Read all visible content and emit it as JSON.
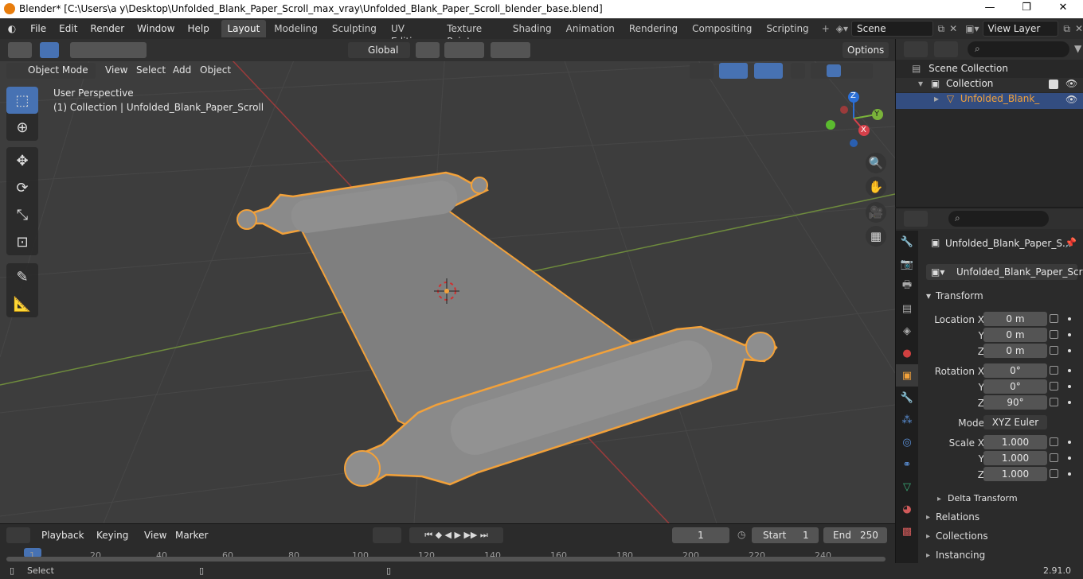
{
  "window": {
    "title": "Blender* [C:\\Users\\a y\\Desktop\\Unfolded_Blank_Paper_Scroll_max_vray\\Unfolded_Blank_Paper_Scroll_blender_base.blend]",
    "min": "—",
    "max": "❐",
    "close": "✕"
  },
  "menus": [
    "File",
    "Edit",
    "Render",
    "Window",
    "Help"
  ],
  "workspaces": [
    "Layout",
    "Modeling",
    "Sculpting",
    "UV Editing",
    "Texture Paint",
    "Shading",
    "Animation",
    "Rendering",
    "Compositing",
    "Scripting"
  ],
  "scene": {
    "name": "Scene"
  },
  "view_layer": {
    "name": "View Layer"
  },
  "viewport": {
    "mode": "Object Mode",
    "menus": [
      "View",
      "Select",
      "Add",
      "Object"
    ],
    "transform_orientation": "Global",
    "options_label": "Options",
    "perspective_label": "User Perspective",
    "collection_label": "(1) Collection | Unfolded_Blank_Paper_Scroll",
    "gizmo": {
      "z": "Z",
      "y": "Y",
      "x": "X"
    }
  },
  "outliner": {
    "items": [
      "Scene Collection",
      "Collection",
      "Unfolded_Blank_Paper_Scroll"
    ]
  },
  "properties": {
    "object_name_short": "Unfolded_Blank_Paper_S...",
    "object_name": "Unfolded_Blank_Paper_Scroll",
    "transform_header": "Transform",
    "location_label": "Location X",
    "y_label": "Y",
    "z_label": "Z",
    "location": [
      "0 m",
      "0 m",
      "0 m"
    ],
    "rotation_label": "Rotation X",
    "rotation": [
      "0°",
      "0°",
      "90°"
    ],
    "mode_label": "Mode",
    "mode_value": "XYZ Euler",
    "scale_label": "Scale X",
    "scale": [
      "1.000",
      "1.000",
      "1.000"
    ],
    "delta": "Delta Transform",
    "sections": [
      "Relations",
      "Collections",
      "Instancing"
    ]
  },
  "timeline": {
    "menus": [
      "Playback",
      "Keying",
      "View",
      "Marker"
    ],
    "current_frame": "1",
    "start_label": "Start",
    "start": "1",
    "end_label": "End",
    "end": "250",
    "ticks": [
      "1",
      "20",
      "40",
      "60",
      "80",
      "100",
      "120",
      "140",
      "160",
      "180",
      "200",
      "220",
      "240"
    ]
  },
  "status": {
    "select": "Select",
    "version": "2.91.0"
  },
  "colors": {
    "accent": "#4772b3",
    "selection": "#f2a13a",
    "bg": "#3d3d3d"
  }
}
